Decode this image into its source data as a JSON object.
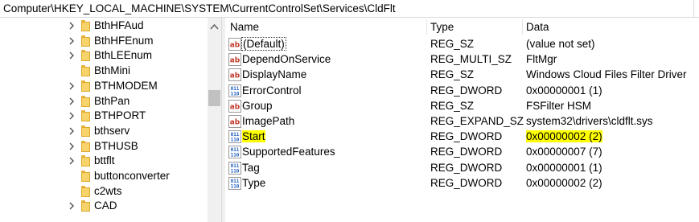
{
  "address": "Computer\\HKEY_LOCAL_MACHINE\\SYSTEM\\CurrentControlSet\\Services\\CldFlt",
  "tree": {
    "items": [
      {
        "label": "BthHFAud",
        "expandable": true
      },
      {
        "label": "BthHFEnum",
        "expandable": true
      },
      {
        "label": "BthLEEnum",
        "expandable": true
      },
      {
        "label": "BthMini",
        "expandable": false
      },
      {
        "label": "BTHMODEM",
        "expandable": true
      },
      {
        "label": "BthPan",
        "expandable": true
      },
      {
        "label": "BTHPORT",
        "expandable": true
      },
      {
        "label": "bthserv",
        "expandable": true
      },
      {
        "label": "BTHUSB",
        "expandable": true
      },
      {
        "label": "bttflt",
        "expandable": true
      },
      {
        "label": "buttonconverter",
        "expandable": false
      },
      {
        "label": "c2wts",
        "expandable": false
      },
      {
        "label": "CAD",
        "expandable": true
      }
    ]
  },
  "list": {
    "columns": {
      "name": "Name",
      "type": "Type",
      "data": "Data"
    },
    "rows": [
      {
        "name": "(Default)",
        "type": "REG_SZ",
        "data": "(value not set)",
        "icon": "string-value-icon",
        "selected": true
      },
      {
        "name": "DependOnService",
        "type": "REG_MULTI_SZ",
        "data": "FltMgr",
        "icon": "string-value-icon"
      },
      {
        "name": "DisplayName",
        "type": "REG_SZ",
        "data": "Windows Cloud Files Filter Driver",
        "icon": "string-value-icon"
      },
      {
        "name": "ErrorControl",
        "type": "REG_DWORD",
        "data": "0x00000001 (1)",
        "icon": "binary-value-icon"
      },
      {
        "name": "Group",
        "type": "REG_SZ",
        "data": "FSFilter HSM",
        "icon": "string-value-icon"
      },
      {
        "name": "ImagePath",
        "type": "REG_EXPAND_SZ",
        "data": "system32\\drivers\\cldflt.sys",
        "icon": "string-value-icon"
      },
      {
        "name": "Start",
        "type": "REG_DWORD",
        "data": "0x00000002 (2)",
        "icon": "binary-value-icon",
        "highlight": true
      },
      {
        "name": "SupportedFeatures",
        "type": "REG_DWORD",
        "data": "0x00000007 (7)",
        "icon": "binary-value-icon"
      },
      {
        "name": "Tag",
        "type": "REG_DWORD",
        "data": "0x00000001 (1)",
        "icon": "binary-value-icon"
      },
      {
        "name": "Type",
        "type": "REG_DWORD",
        "data": "0x00000002 (2)",
        "icon": "binary-value-icon"
      }
    ]
  },
  "colors": {
    "highlight": "#ffff00",
    "folder": "#f7d36b",
    "string_icon": "#c0392b",
    "binary_icon": "#1f5fbf"
  }
}
